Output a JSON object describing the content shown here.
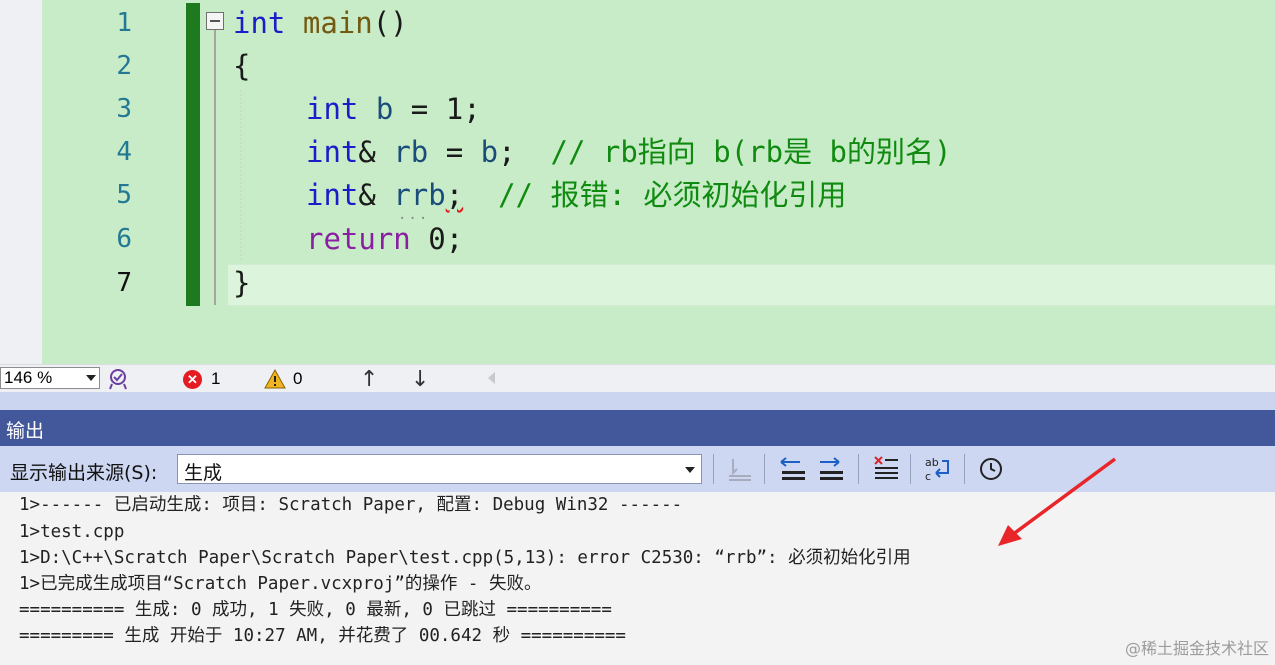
{
  "editor": {
    "line_numbers": [
      "1",
      "2",
      "3",
      "4",
      "5",
      "6",
      "7"
    ],
    "lines": [
      {
        "t1": "int",
        "t2": " ",
        "t3": "main",
        "t4": "()"
      },
      {
        "t1": "{"
      },
      {
        "t1": "int",
        "t2": " ",
        "t3": "b",
        "t4": " = ",
        "t5": "1",
        "t6": ";"
      },
      {
        "t1": "int",
        "t2": "& ",
        "t3": "rb",
        "t4": " = ",
        "t5": "b",
        "t6": ";  ",
        "t7": "// rb指向 b(rb是 b的别名)"
      },
      {
        "t1": "int",
        "t2": "& ",
        "t3": "rrb",
        "t4": ";",
        "t5": "  // 报错: 必须初始化引用"
      },
      {
        "t1": "return",
        "t2": " ",
        "t3": "0",
        "t4": ";"
      },
      {
        "t1": "}"
      }
    ],
    "dots": "···"
  },
  "status": {
    "zoom": "146 %",
    "errors": "1",
    "warnings": "0",
    "up_arrow": "↑",
    "down_arrow": "↓",
    "error_glyph": "✕"
  },
  "output": {
    "title": "输出",
    "source_label": "显示输出来源(S):",
    "source_value": "生成",
    "lines": [
      "1>------ 已启动生成: 项目: Scratch Paper, 配置: Debug Win32 ------",
      "1>test.cpp",
      "1>D:\\C++\\Scratch Paper\\Scratch Paper\\test.cpp(5,13): error C2530: “rrb”: 必须初始化引用",
      "1>已完成生成项目“Scratch Paper.vcxproj”的操作 - 失败。",
      "========== 生成: 0 成功, 1 失败, 0 最新, 0 已跳过 ==========",
      "========= 生成 开始于 10:27 AM, 并花费了 00.642 秒 =========="
    ]
  },
  "watermark": "@稀土掘金技术社区",
  "colors": {
    "editor_bg": "#c8ecc8",
    "change_bar": "#1e7a1e",
    "keyword": "#1c1cc8",
    "comment": "#108a10",
    "output_title_bg": "#42589a",
    "annotation_arrow": "#e8262a"
  }
}
